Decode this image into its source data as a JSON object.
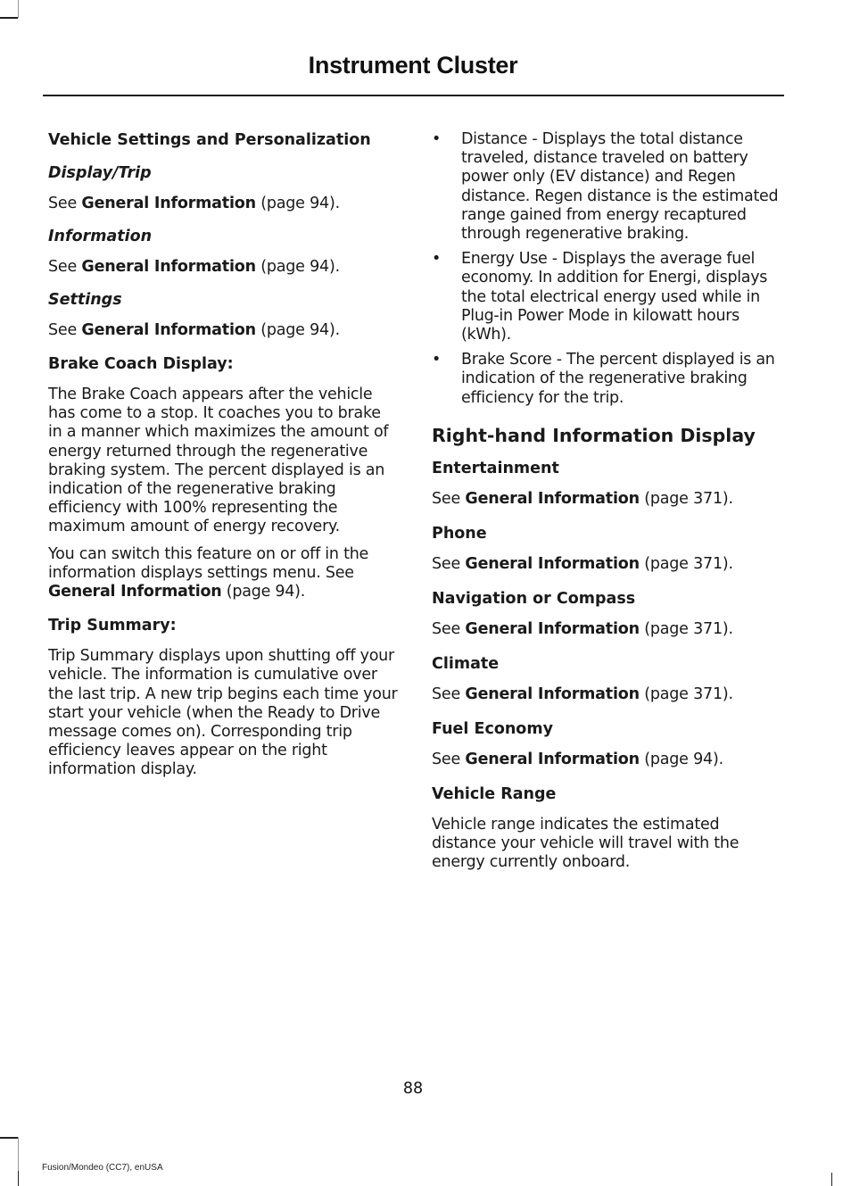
{
  "header": {
    "title": "Instrument Cluster"
  },
  "left_column": {
    "section_heading": "Vehicle Settings and Personalization",
    "subsections": [
      {
        "heading": "Display/Trip",
        "see_prefix": "See",
        "link": "General Information",
        "ref": "(page 94)."
      },
      {
        "heading": "Information",
        "see_prefix": "See",
        "link": "General Information",
        "ref": "(page 94)."
      },
      {
        "heading": "Settings",
        "see_prefix": "See",
        "link": "General Information",
        "ref": "(page 94)."
      }
    ],
    "brake_coach": {
      "heading": "Brake Coach Display:",
      "paragraph1": "The Brake Coach appears after the vehicle has come to a stop. It coaches you to brake in a manner which maximizes the amount of energy returned through the regenerative braking system. The percent displayed is an indication of the regenerative braking efficiency with 100% representing the maximum amount of energy recovery.",
      "paragraph2_text": "You can switch this feature on or off in the information displays settings menu.  See",
      "paragraph2_link": "General Information",
      "paragraph2_ref": "(page 94)."
    },
    "trip_summary": {
      "heading": "Trip Summary:",
      "paragraph": "Trip Summary displays upon shutting off your vehicle. The information is cumulative over the last trip. A new trip begins each time your start your vehicle (when the Ready to Drive message comes on). Corresponding trip efficiency leaves appear on the right information display."
    }
  },
  "right_column": {
    "bullets": [
      "Distance - Displays the total distance traveled, distance traveled on battery power only (EV distance) and Regen distance. Regen distance is the estimated range gained from energy recaptured through regenerative braking.",
      "Energy Use - Displays the average fuel economy. In addition for Energi, displays the total electrical energy used while in Plug-in Power Mode in kilowatt hours (kWh).",
      "Brake Score - The percent displayed is an indication of the regenerative braking efficiency for the trip."
    ],
    "bullet_glyph": "•",
    "section_heading": "Right-hand Information Display",
    "subsections": [
      {
        "heading": "Entertainment",
        "see_prefix": "See",
        "link": "General Information",
        "ref": "(page 371)."
      },
      {
        "heading": "Phone",
        "see_prefix": "See",
        "link": "General Information",
        "ref": "(page 371)."
      },
      {
        "heading": "Navigation or Compass",
        "see_prefix": "See",
        "link": "General Information",
        "ref": "(page 371)."
      },
      {
        "heading": "Climate",
        "see_prefix": "See",
        "link": "General Information",
        "ref": "(page 371)."
      },
      {
        "heading": "Fuel Economy",
        "see_prefix": "See",
        "link": "General Information",
        "ref": "(page 94)."
      }
    ],
    "vehicle_range": {
      "heading": "Vehicle Range",
      "paragraph": "Vehicle range indicates the estimated distance your vehicle will travel with the energy currently onboard."
    }
  },
  "footer": {
    "page_number": "88",
    "document_id": "Fusion/Mondeo (CC7), enUSA"
  }
}
